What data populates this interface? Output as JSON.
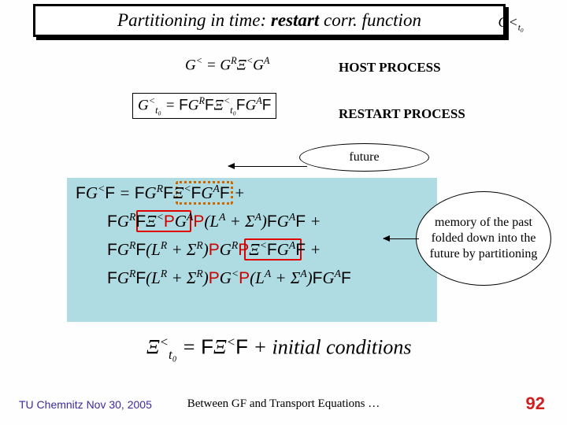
{
  "title": {
    "pre": "Partitioning in time: ",
    "bold": "restart",
    "post": " corr. function",
    "symbol": "G<",
    "symbol_sub": "t₀"
  },
  "host": {
    "eq": "G< = GRΞ<GA",
    "label": "HOST PROCESS"
  },
  "restart": {
    "eq": "G<_{t₀} = F G^R F Ξ<_{t₀} F G^A F",
    "label": "RESTART PROCESS"
  },
  "future_bubble": "future",
  "eq_lines": {
    "l1_pre": "FG<F = FG",
    "l1_mid": "FΞ<F",
    "l1_post": "G^A F +",
    "l2_pre": "FG^R",
    "l2_mid": "FΞ<P",
    "l2_gap": "GA",
    "l2_P": "P",
    "l2_post": "(L^A + Σ^A)FG^A F +",
    "l3_pre": "FG^R",
    "l3_F": "F",
    "l3_mid": "(L^R + Σ^R)",
    "l3_P1": "P",
    "l3_gr": "G^R",
    "l3_P2": "PΞ<F",
    "l3_post": "G^A F +",
    "l4_pre": "FG^R",
    "l4_F": "F",
    "l4_mid": "(L^R + Σ^R)",
    "l4_P1": "P",
    "l4_glt": "G<",
    "l4_P2": "P",
    "l4_post": "(L^A + Σ^A)FG^A F"
  },
  "memory_bubble": "memory of the past folded down into the future by partitioning",
  "bottom_eq": "Ξ<_{t₀} = FΞ<F + initial conditions",
  "footer": {
    "left": "TU Chemnitz Nov 30, 2005",
    "center": "Between GF and Transport Equations …",
    "page": "92"
  }
}
